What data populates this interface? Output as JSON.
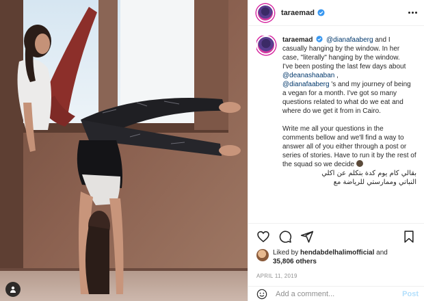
{
  "post": {
    "username": "taraemad",
    "date": "APRIL 11, 2019"
  },
  "caption": {
    "username": "taraemad",
    "line1_mention": "@dianafaaberg",
    "line1_text": " and I casually hanging by the window. In her case, \"literally\" hanging by the window.",
    "line2_text": "I've been posting the last few days about ",
    "line2_mention1": "@deanashaaban",
    "line2_sep": " ,",
    "line2_mention2": "@dianafaaberg",
    "line2_rest": " 's and my journey of being a vegan for a month. I've got so many questions related to what do we eat and where do we get it from in Cairo.",
    "line3_text": "Write me all your questions in the comments bellow and we'll find a way to answer all of you either through a post or series of stories. Have to run it by the rest of the squad so we decide",
    "arabic1": "بقالي كام يوم كدة بتكلم عن اكلي",
    "arabic2": "النباتي وممارستي للرياضة مع"
  },
  "likes": {
    "prefix": "Liked by ",
    "user": "hendabdelhalimofficial",
    "and": " and",
    "count": "35,806 others"
  },
  "comment": {
    "placeholder": "Add a comment...",
    "post_label": "Post"
  },
  "icons": {
    "verified": "verified-badge-icon",
    "more": "more-options-icon",
    "like": "heart-icon",
    "comment": "comment-icon",
    "share": "share-icon",
    "save": "bookmark-icon",
    "emoji": "smiley-icon",
    "tag": "user-tag-icon"
  },
  "colors": {
    "verified_blue": "#3897f0",
    "mention": "#00376b",
    "post_button": "#b2dffc",
    "muted": "#8e8e8e"
  }
}
